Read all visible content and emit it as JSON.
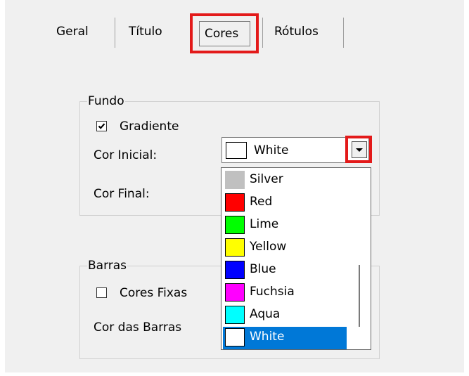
{
  "tabs": {
    "geral": "Geral",
    "titulo": "Título",
    "cores": "Cores",
    "rotulos": "Rótulos"
  },
  "fundo": {
    "legend": "Fundo",
    "gradiente_label": "Gradiente",
    "gradiente_checked": true,
    "cor_inicial_label": "Cor Inicial:",
    "cor_inicial_value": "White",
    "cor_inicial_color": "#ffffff",
    "cor_final_label": "Cor Final:"
  },
  "barras": {
    "legend": "Barras",
    "cores_fixas_label": "Cores Fixas",
    "cores_fixas_checked": false,
    "cor_das_barras_label": "Cor das Barras"
  },
  "dropdown": {
    "arrow_icon": "triangle-down-icon",
    "items": [
      {
        "label": "Silver",
        "color": "#c0c0c0"
      },
      {
        "label": "Red",
        "color": "#ff0000"
      },
      {
        "label": "Lime",
        "color": "#00ff00"
      },
      {
        "label": "Yellow",
        "color": "#ffff00"
      },
      {
        "label": "Blue",
        "color": "#0000ff"
      },
      {
        "label": "Fuchsia",
        "color": "#ff00ff"
      },
      {
        "label": "Aqua",
        "color": "#00ffff"
      },
      {
        "label": "White",
        "color": "#ffffff"
      }
    ],
    "selected_index": 7
  },
  "colors": {
    "highlight": "#e31a1a",
    "selection": "#0078d7",
    "panel_bg": "#f0f0f0"
  }
}
